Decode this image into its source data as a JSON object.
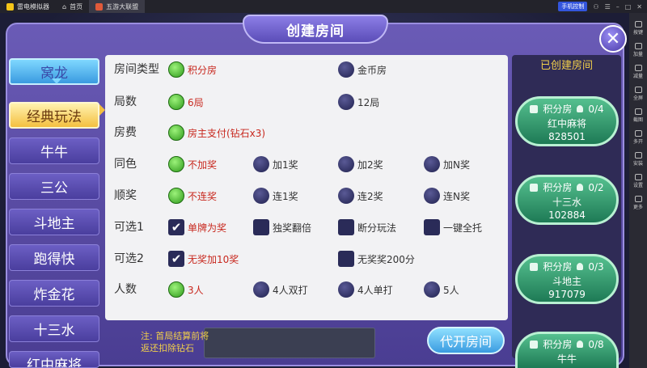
{
  "titlebar": {
    "app_name": "雷电模拟器",
    "tabs": [
      "首页",
      "五游大联盟"
    ],
    "control_btn": "手机控制"
  },
  "sidebar": [
    "按键",
    "加量",
    "减量",
    "全屏",
    "截图",
    "多开",
    "安装",
    "设置",
    "更多"
  ],
  "dialog": {
    "title": "创建房间"
  },
  "categories": [
    "窝龙",
    "经典玩法",
    "牛牛",
    "三公",
    "斗地主",
    "跑得快",
    "炸金花",
    "十三水",
    "红中麻将"
  ],
  "rows": [
    {
      "label": "房间类型",
      "options": [
        "积分房",
        "金币房"
      ]
    },
    {
      "label": "局数",
      "options": [
        "6局",
        "12局"
      ]
    },
    {
      "label": "房费",
      "options": [
        "房主支付(钻石x3)"
      ]
    },
    {
      "label": "同色",
      "options": [
        "不加奖",
        "加1奖",
        "加2奖",
        "加N奖"
      ]
    },
    {
      "label": "顺奖",
      "options": [
        "不连奖",
        "连1奖",
        "连2奖",
        "连N奖"
      ]
    },
    {
      "label": "可选1",
      "options": [
        "单牌为奖",
        "独奖翻倍",
        "断分玩法",
        "一键全托"
      ]
    },
    {
      "label": "可选2",
      "options": [
        "无奖加10奖",
        "无奖奖200分"
      ]
    },
    {
      "label": "人数",
      "options": [
        "3人",
        "4人双打",
        "4人单打",
        "5人"
      ]
    }
  ],
  "note": {
    "line1": "注: 首局结算前将",
    "line2": "返还扣除钻石"
  },
  "open_button": "代开房间",
  "created": {
    "title": "已创建房间",
    "rooms": [
      {
        "type": "积分房",
        "count": "0/4",
        "game": "红中麻将",
        "id": "828501"
      },
      {
        "type": "积分房",
        "count": "0/2",
        "game": "十三水",
        "id": "102884"
      },
      {
        "type": "积分房",
        "count": "0/3",
        "game": "斗地主",
        "id": "917079"
      },
      {
        "type": "积分房",
        "count": "0/8",
        "game": "牛牛",
        "id": ""
      }
    ]
  }
}
